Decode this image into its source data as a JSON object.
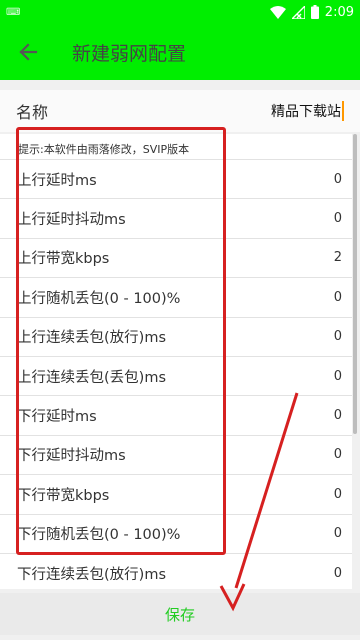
{
  "status_bar": {
    "time": "2:09",
    "icons": [
      "keyboard-icon",
      "wifi-icon",
      "signal-icon",
      "battery-icon"
    ]
  },
  "app_bar": {
    "title": "新建弱网配置",
    "back_icon": "arrow-left-icon"
  },
  "name_field": {
    "label": "名称",
    "value": "精品下载站"
  },
  "tip": "提示:本软件由雨落修改，SVIP版本",
  "rows": [
    {
      "label": "上行延时ms",
      "value": "0"
    },
    {
      "label": "上行延时抖动ms",
      "value": "0"
    },
    {
      "label": "上行带宽kbps",
      "value": "2"
    },
    {
      "label": "上行随机丢包(0 - 100)%",
      "value": "0"
    },
    {
      "label": "上行连续丢包(放行)ms",
      "value": "0"
    },
    {
      "label": "上行连续丢包(丢包)ms",
      "value": "0"
    },
    {
      "label": "下行延时ms",
      "value": "0"
    },
    {
      "label": "下行延时抖动ms",
      "value": "0"
    },
    {
      "label": "下行带宽kbps",
      "value": "0"
    },
    {
      "label": "下行随机丢包(0 - 100)%",
      "value": "0"
    },
    {
      "label": "下行连续丢包(放行)ms",
      "value": "0"
    }
  ],
  "save_label": "保存",
  "colors": {
    "accent": "#00ee00",
    "save_text": "#22cc22",
    "annotation": "#d62020"
  }
}
